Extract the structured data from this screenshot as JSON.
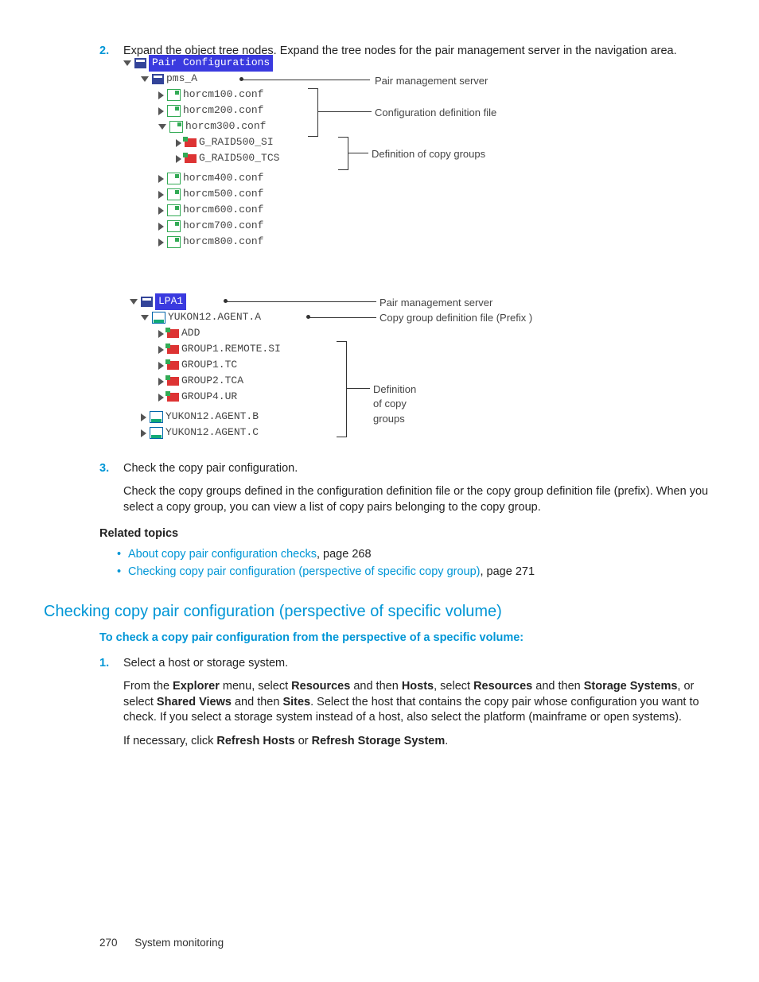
{
  "step2": {
    "num": "2.",
    "text": "Expand the object tree nodes. Expand the tree nodes for the pair management server in the navigation area."
  },
  "diagram1": {
    "root": "Pair Configurations",
    "server": "pms_A",
    "server_label": "Pair management server",
    "files": [
      "horcm100.conf",
      "horcm200.conf",
      "horcm300.conf"
    ],
    "file_label": "Configuration definition file",
    "groups": [
      "G_RAID500_SI",
      "G_RAID500_TCS"
    ],
    "group_label": "Definition of copy groups",
    "more": [
      "horcm400.conf",
      "horcm500.conf",
      "horcm600.conf",
      "horcm700.conf",
      "horcm800.conf"
    ]
  },
  "diagram2": {
    "server": "LPA1",
    "server_label": "Pair management server",
    "agent": "YUKON12.AGENT.A",
    "agent_label": "Copy group definition file (Prefix )",
    "groups": [
      "ADD",
      "GROUP1.REMOTE.SI",
      "GROUP1.TC",
      "GROUP2.TCA",
      "GROUP4.UR"
    ],
    "group_label": "Definition of copy groups",
    "more": [
      "YUKON12.AGENT.B",
      "YUKON12.AGENT.C"
    ]
  },
  "step3": {
    "num": "3.",
    "text": "Check the copy pair configuration.",
    "para": "Check the copy groups defined in the configuration definition file or the copy group definition file (prefix). When you select a copy group, you can view a list of copy pairs belonging to the copy group."
  },
  "related": {
    "heading": "Related topics",
    "items": [
      {
        "link": "About copy pair configuration checks",
        "page": ", page 268"
      },
      {
        "link": "Checking copy pair configuration (perspective of specific copy group)",
        "page": ", page 271"
      }
    ]
  },
  "section": {
    "title": "Checking copy pair configuration (perspective of specific volume)",
    "proc": "To check a copy pair configuration from the perspective of a specific volume:"
  },
  "step1b": {
    "num": "1.",
    "text": "Select a host or storage system.",
    "p1a": "From the ",
    "p1b": "Explorer",
    "p1c": " menu, select ",
    "p1d": "Resources",
    "p1e": " and then ",
    "p1f": "Hosts",
    "p1g": ", select ",
    "p1h": "Resources",
    "p1i": " and then ",
    "p1j": "Storage Systems",
    "p1k": ", or select ",
    "p1l": "Shared Views",
    "p1m": " and then ",
    "p1n": "Sites",
    "p1o": ". Select the host that contains the copy pair whose configuration you want to check. If you select a storage system instead of a host, also select the platform (mainframe or open systems).",
    "p2a": "If necessary, click ",
    "p2b": "Refresh Hosts",
    "p2c": " or ",
    "p2d": "Refresh Storage System",
    "p2e": "."
  },
  "footer": {
    "page": "270",
    "chapter": "System monitoring"
  }
}
